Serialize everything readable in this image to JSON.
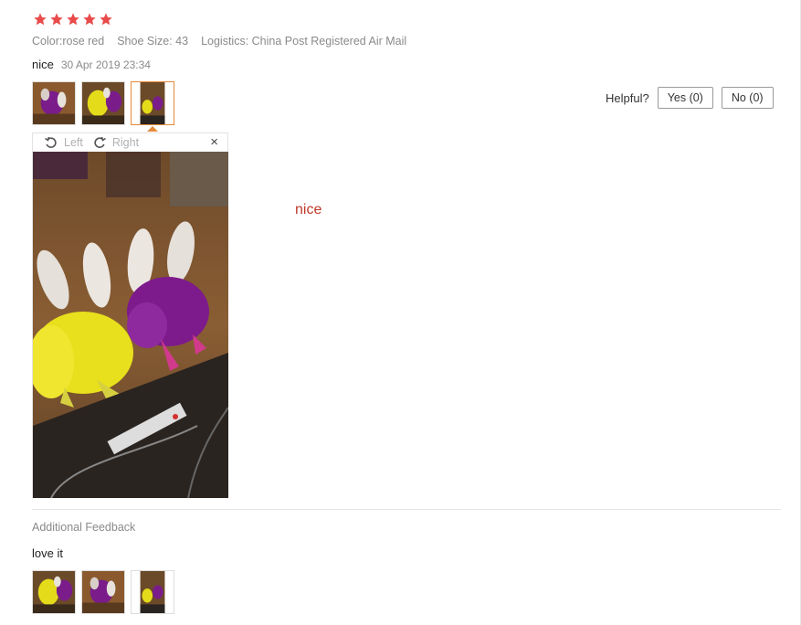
{
  "rating": {
    "stars": 5,
    "max": 5,
    "color": "#e94b4b"
  },
  "attributes": [
    {
      "label": "Color:",
      "value": "rose red"
    },
    {
      "label": "Shoe Size:",
      "value": "43"
    },
    {
      "label": "Logistics:",
      "value": "China Post Registered Air Mail"
    }
  ],
  "review": {
    "text": "nice",
    "date": "30 Apr 2019 23:34"
  },
  "helpful": {
    "label": "Helpful?",
    "yes": "Yes (0)",
    "no": "No (0)"
  },
  "viewer": {
    "rotate_left": "Left",
    "rotate_right": "Right",
    "close": "×"
  },
  "review_body": "nice",
  "additional": {
    "label": "Additional Feedback",
    "text": "love it"
  },
  "colors": {
    "accent": "#e58a3a",
    "body_text": "#c0392b"
  }
}
